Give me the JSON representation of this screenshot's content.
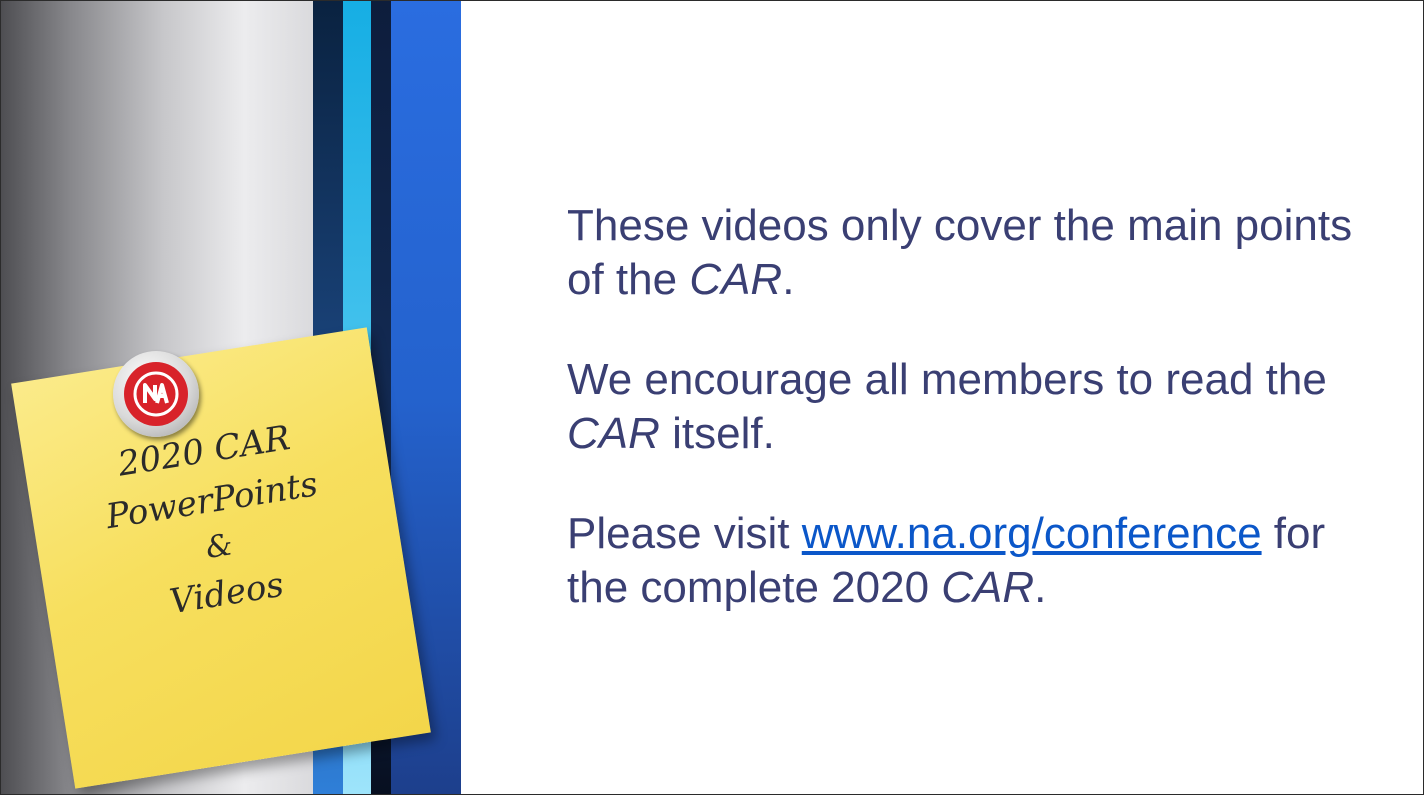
{
  "slide": {
    "note": {
      "line1": "2020 CAR",
      "line2": "PowerPoints",
      "line3": "&",
      "line4": "Videos",
      "pin_logo": "NA"
    },
    "content": {
      "p1_text": "These videos only cover the main points of the ",
      "p1_italic": "CAR",
      "p1_end": ".",
      "p2_text": "We encourage all members to read the ",
      "p2_italic": "CAR",
      "p2_end": " itself.",
      "p3_text": "Please visit ",
      "p3_link": "www.na.org/conference",
      "p3_mid": " for the complete 2020 ",
      "p3_italic": "CAR",
      "p3_end": "."
    }
  },
  "colors": {
    "text": "#3a3f73",
    "link": "#0b57c9",
    "note": "#f7df5e",
    "stripe_dark": "#0a2240",
    "stripe_cyan": "#16aee4",
    "stripe_blue": "#2a6de0"
  },
  "icons": [
    "na-logo-pin"
  ]
}
